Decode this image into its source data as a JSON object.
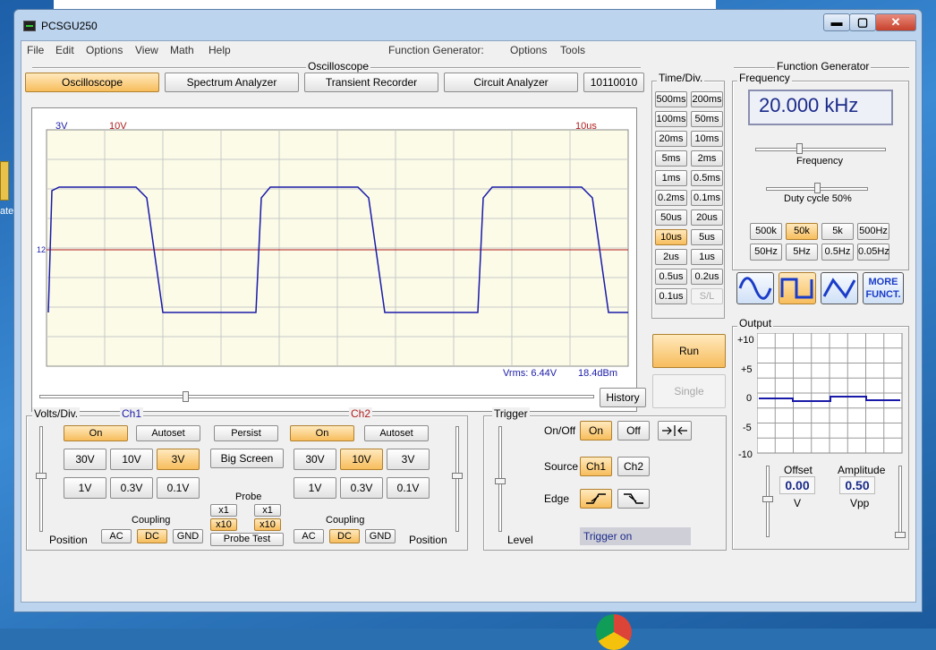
{
  "desktop": {
    "icon_label": "ate"
  },
  "window": {
    "title": "PCSGU250",
    "minimize": "▬",
    "maximize": "▢",
    "close": "✕"
  },
  "menubar": {
    "items": [
      "File",
      "Edit",
      "Options",
      "View",
      "Math",
      "Help"
    ],
    "fg_items": [
      "Function Generator:",
      "Options",
      "Tools"
    ]
  },
  "oscilloscope": {
    "group_title": "Oscilloscope",
    "mode_tabs": [
      "Oscilloscope",
      "Spectrum Analyzer",
      "Transient Recorder",
      "Circuit Analyzer",
      "10110010"
    ],
    "active_tab": "Oscilloscope",
    "screen": {
      "ch1_range": "3V",
      "ch2_range": "10V",
      "timebase": "10us",
      "ch_marker": "12",
      "vrms": "Vrms: 6.44V",
      "dbm": "18.4dBm"
    },
    "history_label": "History"
  },
  "timediv": {
    "title": "Time/Div.",
    "buttons": [
      "500ms",
      "200ms",
      "100ms",
      "50ms",
      "20ms",
      "10ms",
      "5ms",
      "2ms",
      "1ms",
      "0.5ms",
      "0.2ms",
      "0.1ms",
      "50us",
      "20us",
      "10us",
      "5us",
      "2us",
      "1us",
      "0.5us",
      "0.2us",
      "0.1us",
      "S/L"
    ],
    "selected": "10us",
    "run": "Run",
    "single": "Single"
  },
  "volts": {
    "title": "Volts/Div.",
    "ch1": {
      "label": "Ch1",
      "on": "On",
      "autoset": "Autoset",
      "ranges": [
        "30V",
        "10V",
        "3V",
        "1V",
        "0.3V",
        "0.1V"
      ],
      "selected": "3V",
      "coupling": [
        "AC",
        "DC",
        "GND"
      ],
      "coupling_selected": "DC"
    },
    "ch2": {
      "label": "Ch2",
      "on": "On",
      "autoset": "Autoset",
      "ranges": [
        "30V",
        "10V",
        "3V",
        "1V",
        "0.3V",
        "0.1V"
      ],
      "selected": "10V",
      "coupling": [
        "AC",
        "DC",
        "GND"
      ],
      "coupling_selected": "DC"
    },
    "persist": "Persist",
    "big_screen": "Big Screen",
    "probe_title": "Probe",
    "probe_x1": "x1",
    "probe_x10": "x10",
    "probe_test": "Probe Test",
    "coupling_title": "Coupling",
    "position_label": "Position"
  },
  "trigger": {
    "title": "Trigger",
    "onoff_label": "On/Off",
    "on": "On",
    "off": "Off",
    "source_label": "Source",
    "source_ch1": "Ch1",
    "source_ch2": "Ch2",
    "source_selected": "Ch1",
    "edge_label": "Edge",
    "level_label": "Level",
    "status": "Trigger on"
  },
  "function_generator": {
    "title": "Function Generator",
    "frequency_group": "Frequency",
    "frequency_display": "20.000 kHz",
    "frequency_slider_label": "Frequency",
    "duty_cycle": "Duty cycle 50%",
    "range_buttons": [
      "500k",
      "50k",
      "5k",
      "500Hz",
      "50Hz",
      "5Hz",
      "0.5Hz",
      "0.05Hz"
    ],
    "range_selected": "50k",
    "waveforms": [
      "sine-wave",
      "square-wave",
      "triangle-wave"
    ],
    "waveform_selected": "square-wave",
    "more": "MORE FUNCT.",
    "output_title": "Output",
    "output_axis": [
      "+10",
      "+5",
      "0",
      "-5",
      "-10"
    ],
    "offset_label": "Offset",
    "offset_value": "0.00",
    "offset_unit": "V",
    "amplitude_label": "Amplitude",
    "amplitude_value": "0.50",
    "amplitude_unit": "Vpp"
  },
  "colors": {
    "ch1": "#1a1aa8",
    "ch2": "#b01c1c",
    "active_button": "#f7bd5c",
    "screen_bg": "#fbfbe8",
    "grid": "#c8c8c8"
  }
}
